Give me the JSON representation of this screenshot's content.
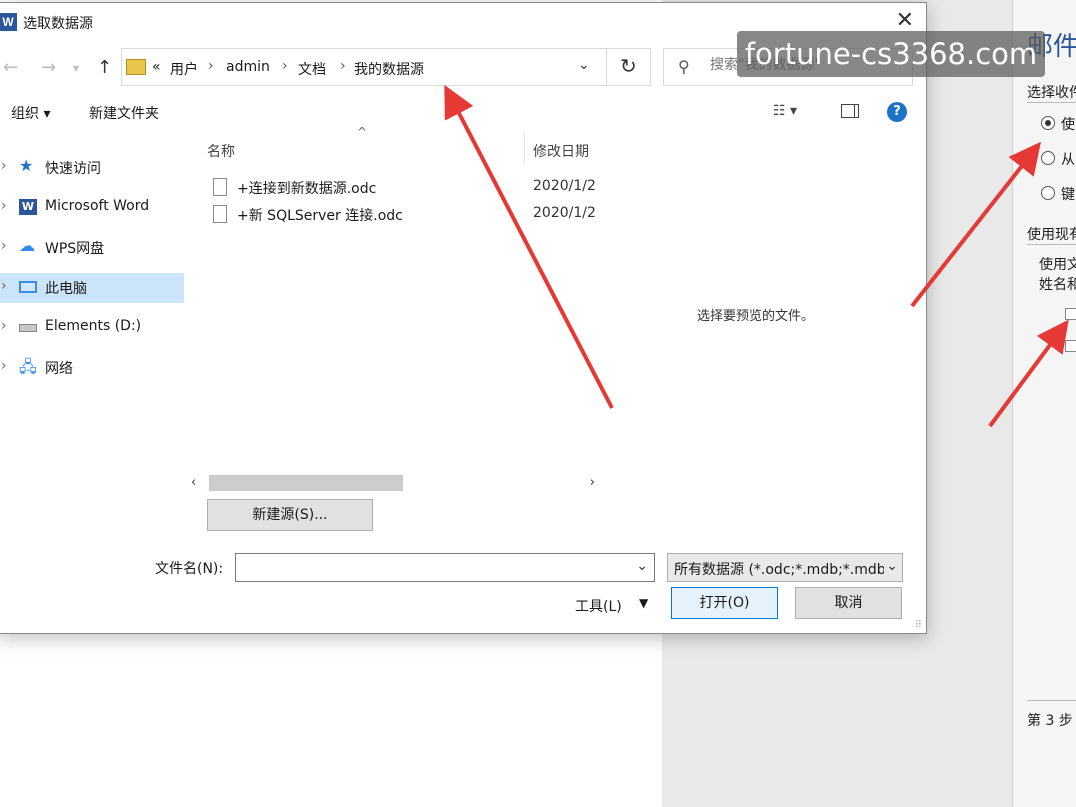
{
  "dialog": {
    "title": "选取数据源",
    "app_icon_letter": "W"
  },
  "address_bar": {
    "overflow": "«",
    "crumbs": [
      "用户",
      "admin",
      "文档",
      "我的数据源"
    ]
  },
  "search": {
    "placeholder": "搜索\"我的数据源\""
  },
  "toolbar": {
    "organize": "组织 ▾",
    "new_folder": "新建文件夹",
    "help": "?"
  },
  "nav": {
    "items": [
      {
        "label": "快速访问"
      },
      {
        "label": "Microsoft Word"
      },
      {
        "label": "WPS网盘"
      },
      {
        "label": "此电脑"
      },
      {
        "label": "Elements (D:)"
      },
      {
        "label": "网络"
      }
    ]
  },
  "columns": {
    "name": "名称",
    "modified": "修改日期"
  },
  "files": [
    {
      "name": "+连接到新数据源.odc",
      "date": "2020/1/2"
    },
    {
      "name": "+新 SQLServer 连接.odc",
      "date": "2020/1/2"
    }
  ],
  "preview": {
    "text": "选择要预览的文件。"
  },
  "buttons": {
    "new_source": "新建源(S)...",
    "tools": "工具(L)",
    "open": "打开(O)",
    "cancel": "取消"
  },
  "filename": {
    "label": "文件名(N):",
    "value": ""
  },
  "filter": {
    "value": "所有数据源 (*.odc;*.mdb;*.mdb;*.mc"
  },
  "side_pane": {
    "title": "邮件",
    "section1": "选择收件",
    "radios": [
      "使",
      "从",
      "键"
    ],
    "section2": "使用现有",
    "desc_line1": "使用文",
    "desc_line2": "姓名和",
    "step": "第 3 步"
  },
  "watermark": "fortune-cs3368.com",
  "colors": {
    "accent": "#2b579a",
    "selection": "#cce4f7",
    "arrow": "#e53935",
    "primary_border": "#0078d7"
  }
}
